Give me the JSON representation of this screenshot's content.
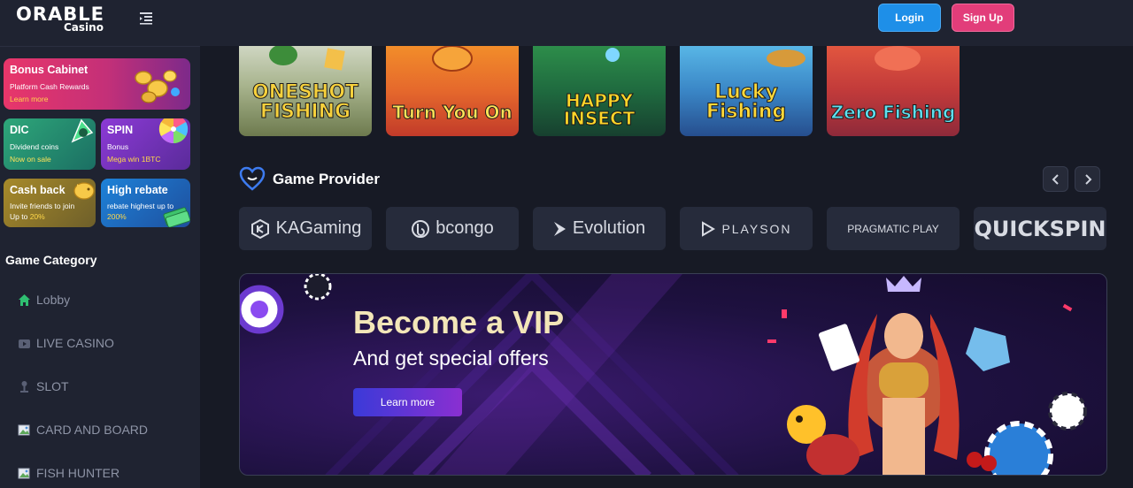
{
  "brand": {
    "name": "ORABLE",
    "sub": "Casino"
  },
  "header": {
    "login_label": "Login",
    "signup_label": "Sign Up"
  },
  "promos": {
    "bonus": {
      "title": "Bonus Cabinet",
      "subtitle": "Platform Cash Rewards",
      "link": "Learn more"
    },
    "dic": {
      "title": "DIC",
      "subtitle": "Dividend coins",
      "link": "Now on sale"
    },
    "spin": {
      "title": "SPIN",
      "subtitle": "Bonus",
      "link": "Mega win 1BTC"
    },
    "cashback": {
      "title": "Cash back",
      "line1": "Invite friends to join",
      "line2_prefix": "Up to ",
      "line2_value": "20%"
    },
    "rebate": {
      "title": "High rebate",
      "line1": "rebate highest up to",
      "line2_value": "200%"
    }
  },
  "category": {
    "title": "Game Category",
    "items": [
      {
        "label": "Lobby",
        "icon": "home-icon",
        "color": "#2fbf71"
      },
      {
        "label": "LIVE CASINO",
        "icon": "live-casino-icon"
      },
      {
        "label": "SLOT",
        "icon": "slot-icon"
      },
      {
        "label": "CARD AND BOARD",
        "icon": "image-icon"
      },
      {
        "label": "FISH HUNTER",
        "icon": "image-icon"
      }
    ]
  },
  "games": [
    {
      "title": "ONESHOT FISHING"
    },
    {
      "title": "Turn You On"
    },
    {
      "title": "HAPPY INSECT"
    },
    {
      "title": "Lucky Fishing"
    },
    {
      "title": "Zero Fishing"
    }
  ],
  "providers_section": {
    "title": "Game Provider",
    "providers": [
      "KAGaming",
      "bcongo",
      "Evolution",
      "PLAYSON",
      "PRAGMATIC PLAY",
      "QUICKSPIN"
    ]
  },
  "vip": {
    "title": "Become a VIP",
    "subtitle": "And get special offers",
    "button": "Learn more"
  },
  "colors": {
    "login": "#1e8fe8",
    "signup": "#e23d7a",
    "vip_title": "#f3e6b8"
  }
}
